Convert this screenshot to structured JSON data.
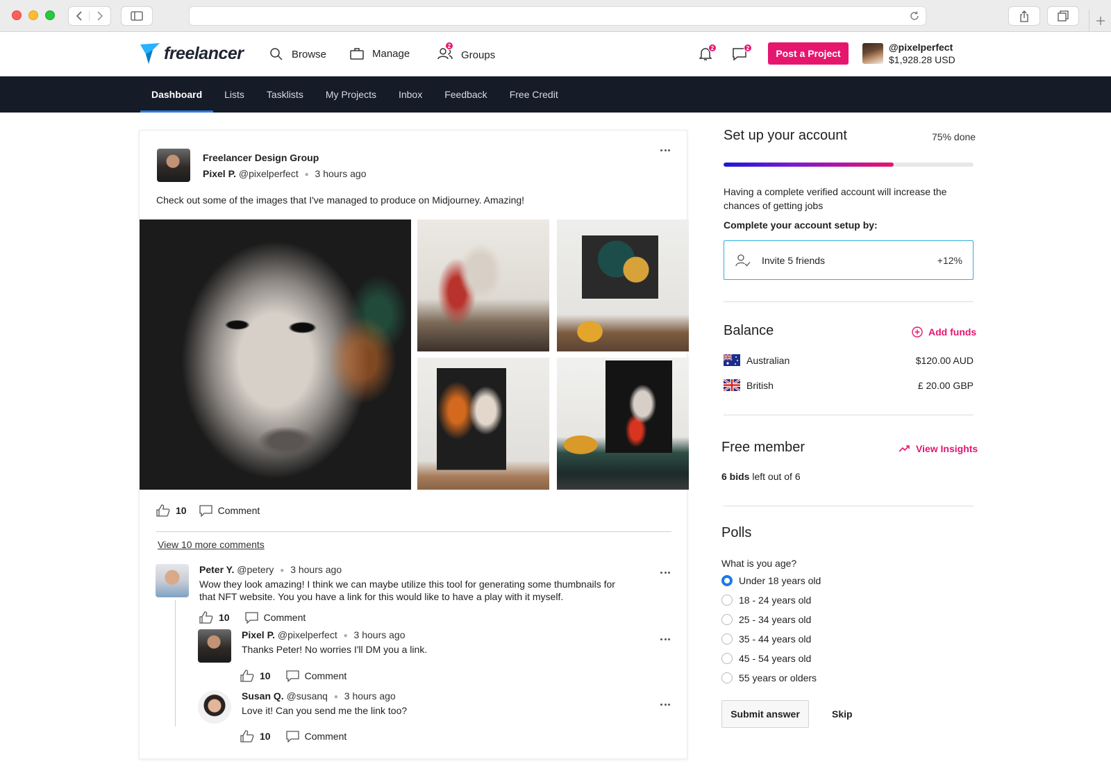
{
  "header": {
    "logo_text": "freelancer",
    "nav": [
      {
        "label": "Browse",
        "icon": "search-icon"
      },
      {
        "label": "Manage",
        "icon": "briefcase-icon"
      },
      {
        "label": "Groups",
        "icon": "groups-icon",
        "badge": "2"
      }
    ],
    "notifications_badge": "2",
    "messages_badge": "2",
    "post_project_label": "Post a Project",
    "username": "@pixelperfect",
    "balance": "$1,928.28 USD"
  },
  "tabs": [
    "Dashboard",
    "Lists",
    "Tasklists",
    "My Projects",
    "Inbox",
    "Feedback",
    "Free Credit"
  ],
  "active_tab": "Dashboard",
  "post": {
    "group": "Freelancer Design Group",
    "author": "Pixel P.",
    "handle": "@pixelperfect",
    "time": "3 hours ago",
    "text": "Check out some of the images that I've managed to produce on Midjourney. Amazing!",
    "likes": "10",
    "comment_label": "Comment",
    "view_more": "View 10 more comments"
  },
  "comments": [
    {
      "author": "Peter Y.",
      "handle": "@petery",
      "time": "3 hours ago",
      "line1": "Wow they look amazing! I think we can maybe utilize this tool for generating some thumbnails for",
      "line2": "that NFT website. You you have a link for this would like to have a play with it myself.",
      "likes": "10",
      "comment_label": "Comment"
    },
    {
      "author": "Pixel P.",
      "handle": "@pixelperfect",
      "time": "3 hours ago",
      "text": "Thanks Peter! No worries I'll DM you a link.",
      "likes": "10",
      "comment_label": "Comment"
    },
    {
      "author": "Susan Q.",
      "handle": "@susanq",
      "time": "3 hours ago",
      "text": "Love it! Can you send me the link too?",
      "likes": "10",
      "comment_label": "Comment"
    }
  ],
  "setup": {
    "title": "Set up your account",
    "progress_label": "75% done",
    "progress": 0.68,
    "description": "Having a complete verified account will increase the chances of getting jobs",
    "subtitle": "Complete your account setup by:",
    "task_label": "Invite 5 friends",
    "task_bonus": "+12%"
  },
  "balance": {
    "title": "Balance",
    "add_funds": "Add funds",
    "rows": [
      {
        "name": "Australian",
        "amount": "$120.00 AUD"
      },
      {
        "name": "British",
        "amount": "£ 20.00 GBP"
      }
    ]
  },
  "membership": {
    "title": "Free member",
    "insights": "View Insights",
    "bids_bold": "6 bids",
    "bids_rest": " left out of 6"
  },
  "polls": {
    "title": "Polls",
    "question": "What is you age?",
    "options": [
      "Under 18 years old",
      "18 - 24 years old",
      "25 - 34 years old",
      "35 - 44 years old",
      "45 - 54 years old",
      "55 years or olders"
    ],
    "selected_index": 0,
    "submit": "Submit answer",
    "skip": "Skip"
  },
  "colors": {
    "accent": "#e6166f",
    "navbar": "#151b27",
    "active_tab_underline": "#2a7bde",
    "radio_selected": "#1b7ae8",
    "invite_border": "#2eaee0"
  }
}
